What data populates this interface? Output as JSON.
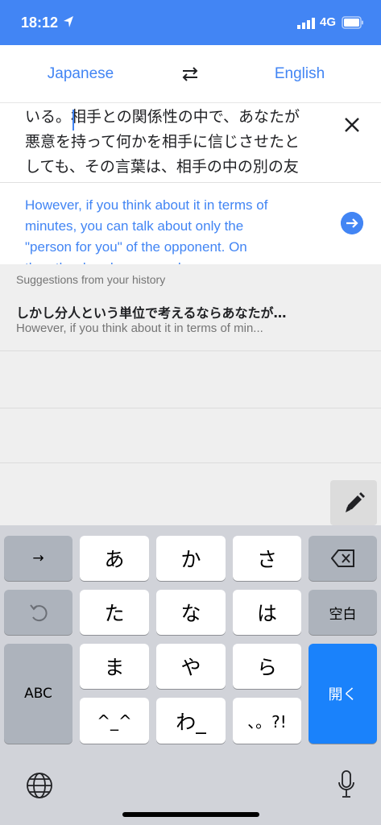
{
  "status_bar": {
    "time": "18:12",
    "network": "4G",
    "color": "#4285f4"
  },
  "languages": {
    "source": "Japanese",
    "target": "English",
    "swap_icon": "swap-arrows-icon"
  },
  "source_text": {
    "lines": [
      "いる。相手との関係性の中で、あなたが",
      "悪意を持って何かを相手に信じさせたと",
      "しても、その言葉は、相手の中の別の友"
    ]
  },
  "translation": {
    "lines": [
      "However, if you think about it in terms of",
      "minutes, you can talk about only the",
      "\"person for you\" of the opponent. On",
      "the other hand, your words are"
    ]
  },
  "suggestions": {
    "header": "Suggestions from your history",
    "items": [
      {
        "title": "しかし分人という単位で考えるならあなたが…",
        "subtitle": "However, if you think about it in terms of min..."
      }
    ]
  },
  "keyboard": {
    "keys": {
      "r1": [
        "→",
        "あ",
        "か",
        "さ"
      ],
      "r2": [
        "た",
        "な",
        "は",
        "空白"
      ],
      "r3": [
        "ABC",
        "ま",
        "や",
        "ら",
        "開く"
      ],
      "r4": [
        "^_^",
        "わ_",
        "、。?!"
      ]
    },
    "accent": "#1a82fb"
  }
}
